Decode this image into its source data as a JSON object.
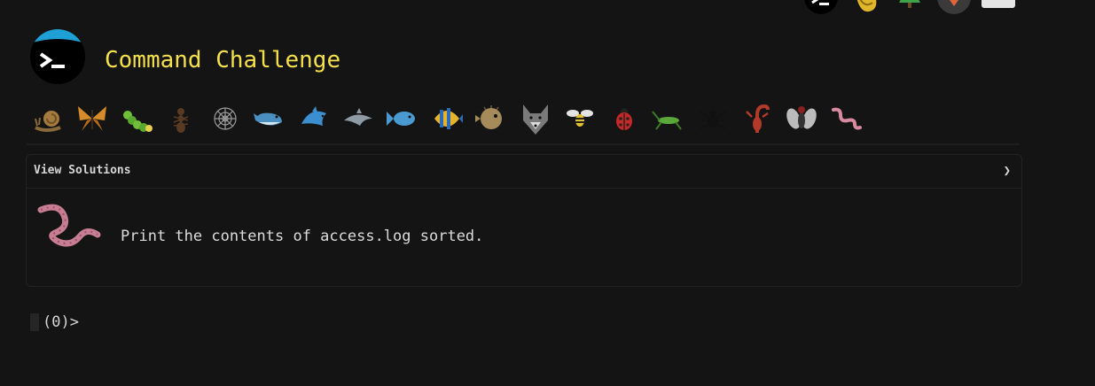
{
  "header": {
    "title": "Command Challenge"
  },
  "top_icons": [
    "terminal-icon",
    "hand-icon",
    "tree-icon",
    "gitlab-icon",
    "mail-icon"
  ],
  "creatures": [
    "snail",
    "butterfly",
    "caterpillar",
    "ant",
    "spider-web",
    "whale",
    "dolphin-blue",
    "dolphin-gray",
    "fish",
    "tropical-fish",
    "blowfish",
    "wolf",
    "bee",
    "ladybug",
    "cricket",
    "spider",
    "scorpion",
    "fly",
    "worm"
  ],
  "card": {
    "header_label": "View Solutions",
    "chevron": "❯",
    "task_text": "Print the contents of access.log sorted."
  },
  "prompt": {
    "text": "(0)>"
  },
  "colors": {
    "background": "#141414",
    "title": "#f4e04b",
    "text": "#d8d8d8"
  }
}
